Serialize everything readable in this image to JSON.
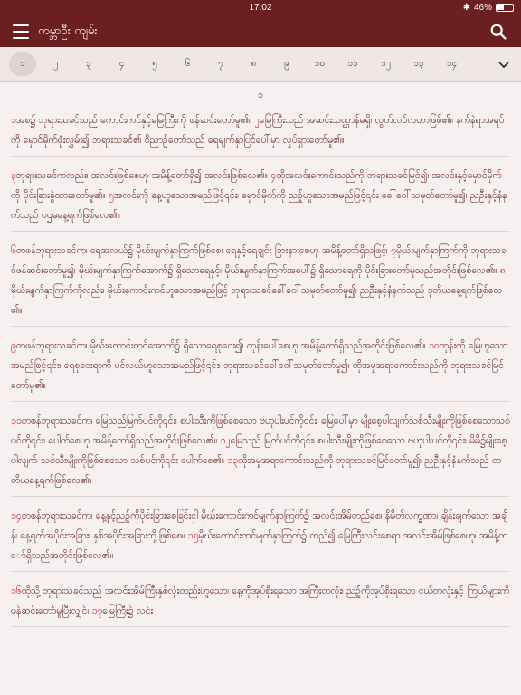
{
  "status": {
    "time": "17:02",
    "battery": "46%",
    "battery_level": 0.46
  },
  "app": {
    "title": "ကမ္ဘာဦး ကျမ်း"
  },
  "tabs": [
    "၁",
    "၂",
    "၃",
    "၄",
    "၅",
    "၆",
    "၇",
    "၈",
    "၉",
    "၁၀",
    "၁၁",
    "၁၂",
    "၁၃",
    "၁၄"
  ],
  "chapter": "၁",
  "verses": [
    {
      "segments": [
        {
          "n": "၁",
          "t": "အစ၌ ဘုရားသခင်သည် ကောင်းကင်နှင့်မြေကြီးကို ဖန်ဆင်းတော်မူ၏။ "
        },
        {
          "n": "၂",
          "t": "မြေကြီးသည် အဆင်းသဏ္ဌာန်မရှိ၊ လွတ်လပ်လဟာဖြစ်၏။ နက်နဲရာအရပ်ကို မှောင်မိုက်ဖုံးလွှမ်း၍ ဘုရားသခင်၏ ဝိညာဉ်တော်သည် ရေမျက်နှာပြင်ပေါ်မှာ လှုပ်ရှားတော်မူ၏။"
        }
      ]
    },
    {
      "segments": [
        {
          "n": "၃",
          "t": "ဘုရားသခင်ကလည်း၊ အလင်းဖြစ်စေဟု အမိန့်တော်ရှိ၍ အလင်းဖြစ်လေ၏။ "
        },
        {
          "n": "၄",
          "t": "ထိုအလင်းကောင်းသည်ကို ဘုရားသခင်မြင်၍၊ အလင်းနှင့်မှောင်မိုက်ကို ပိုင်းခြားခွဲထားတော်မူ၏။ "
        },
        {
          "n": "၅",
          "t": "အလင်းကို နေ့ဟူသောအမည်ဖြင့်၎င်း၊ မှောင်မိုက်ကို ညဉ့်ဟူသောအမည်ဖြင့်၎င်း ခေါ်ဝေါ်သမုတ်တော်မူ၍၊ ညဦးနှင့်နံနက်သည် ပဌမနေ့ရက်ဖြစ်လေ၏။"
        }
      ]
    },
    {
      "segments": [
        {
          "n": "၆",
          "t": "တဖန်ဘုရားသခင်က၊ ရေအလယ်၌ မိုဃ်းမျက်နှာကြက်ဖြစ်စေ၊ ရေနှင့်ရေချင်း ခြားနားစေဟု အမိန့်တော်ရှိသဖြင့်၊ "
        },
        {
          "n": "၇",
          "t": "မိုဃ်းမျက်နှာကြက်ကို ဘုရားသခင်ဖန်ဆင်းတော်မူ၍၊ မိုဃ်းမျက်နှာကြက်အောက်၌ ရှိသောရေနှင့်၊ မိုဃ်းမျက်နှာကြက်အပေါ်၌ ရှိသောရေကို ပိုင်းခြားတော်မူသည်အတိုင်းဖြစ်လေ၏။ "
        },
        {
          "n": "၈",
          "t": "မိုဃ်းမျက်နှာကြက်ကိုလည်း၊ မိုဃ်းကောင်းကင်ဟူသောအမည်ဖြင့် ဘုရားသခင်ခေါ်ဝေါ်သမုတ်တော်မူ၍၊ ညဦးနှင့်နံနက်သည် ဒုတိယနေ့ရက်ဖြစ်လေ၏။"
        }
      ]
    },
    {
      "segments": [
        {
          "n": "၉",
          "t": "တဖန်ဘုရားသခင်က၊ မိုဃ်းကောင်းကင်အောက်၌ ရှိသောရေစုဝေး၍၊ ကုန်းပေါ်စေဟု အမိန့်တော်ရှိသည်အတိုင်းဖြစ်လေ၏။ "
        },
        {
          "n": "၁၀",
          "t": "ကုန်းကို မြေဟူသောအမည်ဖြင့်၎င်း၊ ရေစုဝေးရာကို ပင်လယ်ဟူသောအမည်ဖြင့်၎င်း၊ ဘုရားသခင်ခေါ်ဝေါ်သမုတ်တော်မူ၍၊ ထိုအမှုအရာကောင်းသည်ကို ဘုရားသခင်မြင်တော်မူ၏။"
        }
      ]
    },
    {
      "segments": [
        {
          "n": "၁၁",
          "t": "တဖန်ဘုရားသခင်က၊ မြေသည်မြက်ပင်ကို၎င်း၊ စပါးသီးကိုဖြစ်စေသော ဗဟုပါးပင်ကို၎င်း၊ မြေပေါ်မှာ မျိုးစေ့ပါလျက်သစ်သီးမျိုးကိုဖြစ်စေသောသစ်ပင်ကို၎င်း၊ ပေါက်စေဟု အမိန့်တော်ရှိသည်အတိုင်းဖြစ်လေ၏။ "
        },
        {
          "n": "၁၂",
          "t": "မြေသည် မြက်ပင်ကို၎င်း၊ စပါးသီးမျိုးကိုဖြစ်စေသော ဗဟုပါးပင်ကို၎င်း၊ မိမိ၌မျိုးစေ့ပါလျက် သစ်သီးမျိုးကိုဖြစ်စေသော သစ်ပင်ကို၎င်း ပေါက်စေ၏။ "
        },
        {
          "n": "၁၃",
          "t": "ထိုအမှုအရာကောင်းသည်ကို ဘုရားသခင်မြင်တော်မူ၍၊ ညဦးနှင့်နံနက်သည် တတိယနေ့ရက်ဖြစ်လေ၏။"
        }
      ]
    },
    {
      "segments": [
        {
          "n": "၁၄",
          "t": "တဖန်ဘုရားသခင်က၊ နေ့နှင့်ညဉ့်ကိုပိုင်းခြားစေခြင်းငှါ မိုဃ်းကောင်းကင်မျက်နှာကြက်၌ အလင်းအိမ်တည်စေ၊ နိမိတ်လက္ခဏာ၊ ချိန်းချက်သော အချိန်၊ နေ့ရက်အပိုင်းအခြား၊ နှစ်အပိုင်းအခြားဘို့ဖြစ်စေ။ "
        },
        {
          "n": "၁၅",
          "t": "မိုဃ်းကောင်းကင်မျက်နှာကြက်၌ တည်၍ မြေကြီးလင်းစေရာ အလင်းအိမ်ဖြစ်စေဟု၊ အမိန့်တော်ရှိသည်အတိုင်းဖြစ်လေ၏။"
        }
      ]
    },
    {
      "segments": [
        {
          "n": "၁၆",
          "t": "ထိုသို့ ဘုရားသခင်သည် အလင်းအိမ်ကြီးနှစ်လုံးတည်းဟူသော၊ နေ့ကိုအုပ်စိုးရသော အကြီးတလုံး၊ ညဉ့်ကိုအုပ်စိုးရသော ငယ်တလုံးနှင့် ကြယ်များကိုဖန်ဆင်းတော်မူပြီးလျှင်၊ "
        },
        {
          "n": "၁၇",
          "t": "မြေကြီး၌ လင်း"
        }
      ]
    }
  ]
}
